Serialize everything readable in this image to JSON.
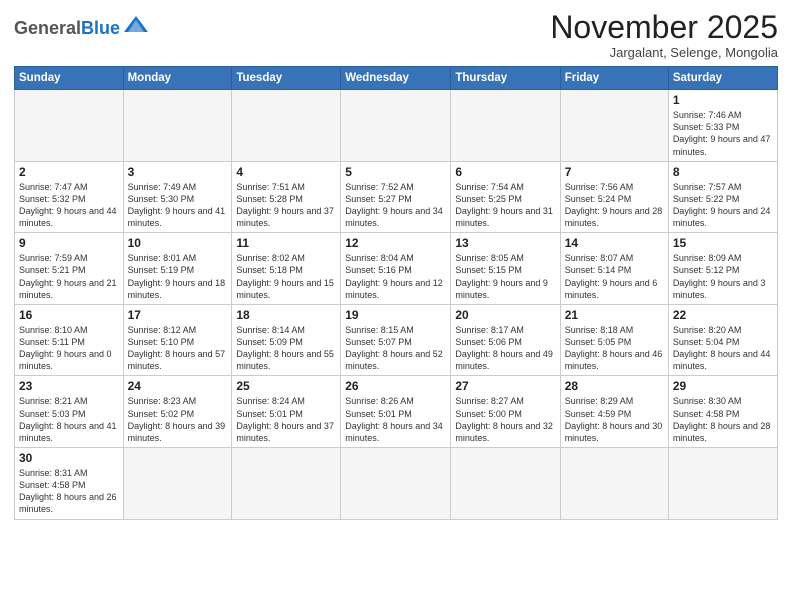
{
  "header": {
    "logo": {
      "general": "General",
      "blue": "Blue"
    },
    "title": "November 2025",
    "subtitle": "Jargalant, Selenge, Mongolia"
  },
  "weekdays": [
    "Sunday",
    "Monday",
    "Tuesday",
    "Wednesday",
    "Thursday",
    "Friday",
    "Saturday"
  ],
  "weeks": [
    [
      {
        "day": "",
        "info": ""
      },
      {
        "day": "",
        "info": ""
      },
      {
        "day": "",
        "info": ""
      },
      {
        "day": "",
        "info": ""
      },
      {
        "day": "",
        "info": ""
      },
      {
        "day": "",
        "info": ""
      },
      {
        "day": "1",
        "info": "Sunrise: 7:46 AM\nSunset: 5:33 PM\nDaylight: 9 hours\nand 47 minutes."
      }
    ],
    [
      {
        "day": "2",
        "info": "Sunrise: 7:47 AM\nSunset: 5:32 PM\nDaylight: 9 hours\nand 44 minutes."
      },
      {
        "day": "3",
        "info": "Sunrise: 7:49 AM\nSunset: 5:30 PM\nDaylight: 9 hours\nand 41 minutes."
      },
      {
        "day": "4",
        "info": "Sunrise: 7:51 AM\nSunset: 5:28 PM\nDaylight: 9 hours\nand 37 minutes."
      },
      {
        "day": "5",
        "info": "Sunrise: 7:52 AM\nSunset: 5:27 PM\nDaylight: 9 hours\nand 34 minutes."
      },
      {
        "day": "6",
        "info": "Sunrise: 7:54 AM\nSunset: 5:25 PM\nDaylight: 9 hours\nand 31 minutes."
      },
      {
        "day": "7",
        "info": "Sunrise: 7:56 AM\nSunset: 5:24 PM\nDaylight: 9 hours\nand 28 minutes."
      },
      {
        "day": "8",
        "info": "Sunrise: 7:57 AM\nSunset: 5:22 PM\nDaylight: 9 hours\nand 24 minutes."
      }
    ],
    [
      {
        "day": "9",
        "info": "Sunrise: 7:59 AM\nSunset: 5:21 PM\nDaylight: 9 hours\nand 21 minutes."
      },
      {
        "day": "10",
        "info": "Sunrise: 8:01 AM\nSunset: 5:19 PM\nDaylight: 9 hours\nand 18 minutes."
      },
      {
        "day": "11",
        "info": "Sunrise: 8:02 AM\nSunset: 5:18 PM\nDaylight: 9 hours\nand 15 minutes."
      },
      {
        "day": "12",
        "info": "Sunrise: 8:04 AM\nSunset: 5:16 PM\nDaylight: 9 hours\nand 12 minutes."
      },
      {
        "day": "13",
        "info": "Sunrise: 8:05 AM\nSunset: 5:15 PM\nDaylight: 9 hours\nand 9 minutes."
      },
      {
        "day": "14",
        "info": "Sunrise: 8:07 AM\nSunset: 5:14 PM\nDaylight: 9 hours\nand 6 minutes."
      },
      {
        "day": "15",
        "info": "Sunrise: 8:09 AM\nSunset: 5:12 PM\nDaylight: 9 hours\nand 3 minutes."
      }
    ],
    [
      {
        "day": "16",
        "info": "Sunrise: 8:10 AM\nSunset: 5:11 PM\nDaylight: 9 hours\nand 0 minutes."
      },
      {
        "day": "17",
        "info": "Sunrise: 8:12 AM\nSunset: 5:10 PM\nDaylight: 8 hours\nand 57 minutes."
      },
      {
        "day": "18",
        "info": "Sunrise: 8:14 AM\nSunset: 5:09 PM\nDaylight: 8 hours\nand 55 minutes."
      },
      {
        "day": "19",
        "info": "Sunrise: 8:15 AM\nSunset: 5:07 PM\nDaylight: 8 hours\nand 52 minutes."
      },
      {
        "day": "20",
        "info": "Sunrise: 8:17 AM\nSunset: 5:06 PM\nDaylight: 8 hours\nand 49 minutes."
      },
      {
        "day": "21",
        "info": "Sunrise: 8:18 AM\nSunset: 5:05 PM\nDaylight: 8 hours\nand 46 minutes."
      },
      {
        "day": "22",
        "info": "Sunrise: 8:20 AM\nSunset: 5:04 PM\nDaylight: 8 hours\nand 44 minutes."
      }
    ],
    [
      {
        "day": "23",
        "info": "Sunrise: 8:21 AM\nSunset: 5:03 PM\nDaylight: 8 hours\nand 41 minutes."
      },
      {
        "day": "24",
        "info": "Sunrise: 8:23 AM\nSunset: 5:02 PM\nDaylight: 8 hours\nand 39 minutes."
      },
      {
        "day": "25",
        "info": "Sunrise: 8:24 AM\nSunset: 5:01 PM\nDaylight: 8 hours\nand 37 minutes."
      },
      {
        "day": "26",
        "info": "Sunrise: 8:26 AM\nSunset: 5:01 PM\nDaylight: 8 hours\nand 34 minutes."
      },
      {
        "day": "27",
        "info": "Sunrise: 8:27 AM\nSunset: 5:00 PM\nDaylight: 8 hours\nand 32 minutes."
      },
      {
        "day": "28",
        "info": "Sunrise: 8:29 AM\nSunset: 4:59 PM\nDaylight: 8 hours\nand 30 minutes."
      },
      {
        "day": "29",
        "info": "Sunrise: 8:30 AM\nSunset: 4:58 PM\nDaylight: 8 hours\nand 28 minutes."
      }
    ],
    [
      {
        "day": "30",
        "info": "Sunrise: 8:31 AM\nSunset: 4:58 PM\nDaylight: 8 hours\nand 26 minutes."
      },
      {
        "day": "",
        "info": ""
      },
      {
        "day": "",
        "info": ""
      },
      {
        "day": "",
        "info": ""
      },
      {
        "day": "",
        "info": ""
      },
      {
        "day": "",
        "info": ""
      },
      {
        "day": "",
        "info": ""
      }
    ]
  ]
}
